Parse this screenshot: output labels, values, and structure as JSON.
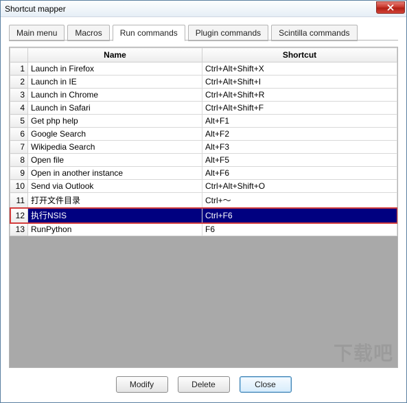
{
  "window": {
    "title": "Shortcut mapper"
  },
  "tabs": [
    {
      "label": "Main menu"
    },
    {
      "label": "Macros"
    },
    {
      "label": "Run commands"
    },
    {
      "label": "Plugin commands"
    },
    {
      "label": "Scintilla commands"
    }
  ],
  "active_tab_index": 2,
  "columns": {
    "name": "Name",
    "shortcut": "Shortcut"
  },
  "rows": [
    {
      "num": "1",
      "name": "Launch in Firefox",
      "shortcut": "Ctrl+Alt+Shift+X",
      "selected": false
    },
    {
      "num": "2",
      "name": "Launch in IE",
      "shortcut": "Ctrl+Alt+Shift+I",
      "selected": false
    },
    {
      "num": "3",
      "name": "Launch in Chrome",
      "shortcut": "Ctrl+Alt+Shift+R",
      "selected": false
    },
    {
      "num": "4",
      "name": "Launch in Safari",
      "shortcut": "Ctrl+Alt+Shift+F",
      "selected": false
    },
    {
      "num": "5",
      "name": "Get php help",
      "shortcut": "Alt+F1",
      "selected": false
    },
    {
      "num": "6",
      "name": "Google Search",
      "shortcut": "Alt+F2",
      "selected": false
    },
    {
      "num": "7",
      "name": "Wikipedia Search",
      "shortcut": "Alt+F3",
      "selected": false
    },
    {
      "num": "8",
      "name": "Open file",
      "shortcut": "Alt+F5",
      "selected": false
    },
    {
      "num": "9",
      "name": "Open in another instance",
      "shortcut": "Alt+F6",
      "selected": false
    },
    {
      "num": "10",
      "name": "Send via Outlook",
      "shortcut": "Ctrl+Alt+Shift+O",
      "selected": false
    },
    {
      "num": "11",
      "name": "打开文件目录",
      "shortcut": "Ctrl+～",
      "selected": false
    },
    {
      "num": "12",
      "name": "执行NSIS",
      "shortcut": "Ctrl+F6",
      "selected": true
    },
    {
      "num": "13",
      "name": "RunPython",
      "shortcut": "F6",
      "selected": false
    }
  ],
  "buttons": {
    "modify": "Modify",
    "delete": "Delete",
    "close": "Close"
  },
  "watermark": "下载吧",
  "highlight_row_index": 11
}
